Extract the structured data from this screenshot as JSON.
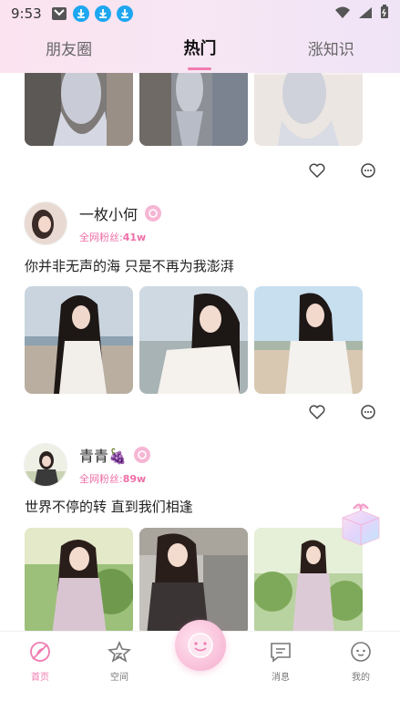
{
  "status_bar": {
    "time": "9:53"
  },
  "top_tabs": [
    {
      "label": "朋友圈"
    },
    {
      "label": "热门"
    },
    {
      "label": "涨知识"
    }
  ],
  "posts": [
    {
      "username": "一枚小何",
      "fans_label": "全网粉丝:",
      "fans_count": "41w",
      "text": "你并非无声的海 只是不再为我澎湃"
    },
    {
      "username": "青青🍇",
      "fans_label": "全网粉丝:",
      "fans_count": "89w",
      "text": "世界不停的转 直到我们相逢"
    }
  ],
  "bottom_nav": {
    "home": "首页",
    "space": "空间",
    "messages": "消息",
    "mine": "我的"
  },
  "colors": {
    "accent": "#f07bb0",
    "fans": "#ee6fa7"
  }
}
